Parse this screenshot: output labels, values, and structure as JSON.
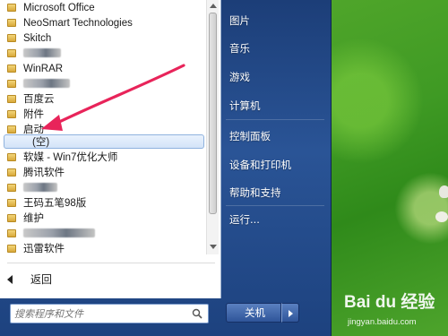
{
  "start_menu": {
    "programs": [
      {
        "label": "Microsoft Office",
        "blurred": false
      },
      {
        "label": "NeoSmart Technologies",
        "blurred": false
      },
      {
        "label": "Skitch",
        "blurred": false
      },
      {
        "label": "",
        "blurred": true
      },
      {
        "label": "WinRAR",
        "blurred": false
      },
      {
        "label": "",
        "blurred": true
      },
      {
        "label": "百度云",
        "blurred": false
      },
      {
        "label": "附件",
        "blurred": false
      },
      {
        "label": "启动",
        "blurred": false
      },
      {
        "label": "(空)",
        "blurred": false,
        "selected": true
      },
      {
        "label": "软媒 - Win7优化大师",
        "blurred": false
      },
      {
        "label": "腾讯软件",
        "blurred": false
      },
      {
        "label": "",
        "blurred": true
      },
      {
        "label": "王码五笔98版",
        "blurred": false
      },
      {
        "label": "维护",
        "blurred": false
      },
      {
        "label": "",
        "blurred": true
      },
      {
        "label": "迅雷软件",
        "blurred": false
      }
    ],
    "back_label": "返回",
    "search_placeholder": "搜索程序和文件",
    "right_items": {
      "pictures": "图片",
      "music": "音乐",
      "games": "游戏",
      "computer": "计算机",
      "control_panel": "控制面板",
      "devices_printers": "设备和打印机",
      "help_support": "帮助和支持",
      "run": "运行..."
    },
    "shutdown_label": "关机"
  },
  "watermark": {
    "logo": "Bai du 经验",
    "url": "jingyan.baidu.com"
  },
  "colors": {
    "annotation_arrow": "#e8245a",
    "menu_blue": "#2a5496",
    "wallpaper_green": "#3f9a24"
  }
}
